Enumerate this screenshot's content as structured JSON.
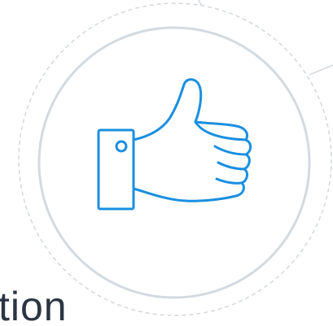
{
  "caption": {
    "partial_text": "tion"
  },
  "icon": {
    "name": "thumbs-up-icon"
  },
  "colors": {
    "icon_stroke": "#1a8fe0",
    "ring_solid": "#d3dae0",
    "ring_dashed": "#cfd5db",
    "text": "#2b3542",
    "background": "#ffffff"
  }
}
